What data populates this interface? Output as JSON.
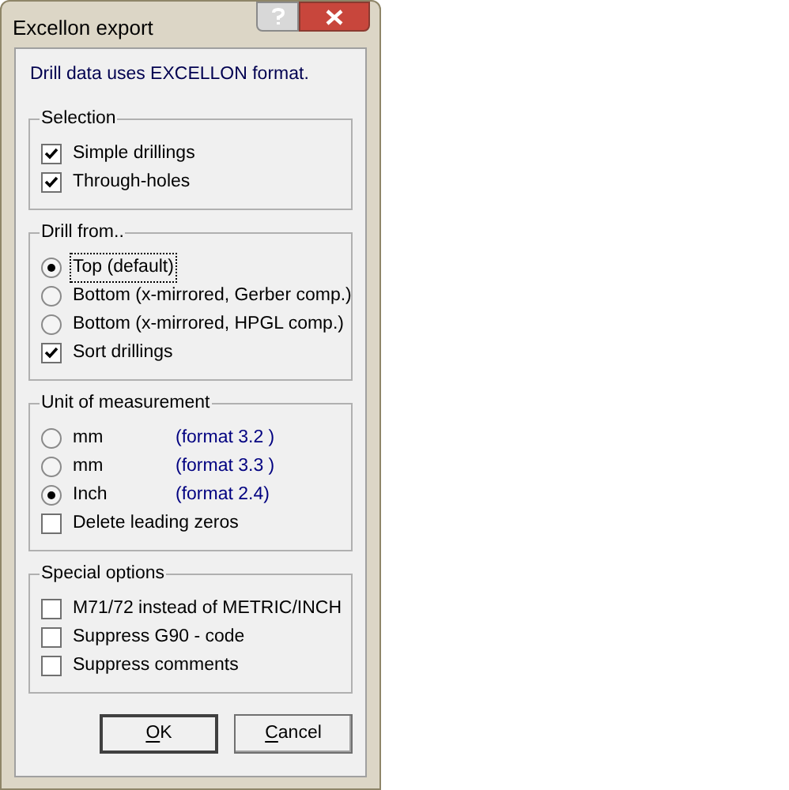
{
  "window": {
    "title": "Excellon export"
  },
  "intro": "Drill data uses EXCELLON format.",
  "groups": [
    {
      "title": "Selection",
      "items": [
        {
          "kind": "checkbox",
          "label": "Simple drillings",
          "checked": true,
          "focused": false
        },
        {
          "kind": "checkbox",
          "label": "Through-holes",
          "checked": true,
          "focused": false
        }
      ]
    },
    {
      "title": "Drill from..",
      "items": [
        {
          "kind": "radio",
          "label": "Top (default)",
          "selected": true,
          "focused": true
        },
        {
          "kind": "radio",
          "label": "Bottom (x-mirrored, Gerber comp.)",
          "selected": false,
          "focused": false
        },
        {
          "kind": "radio",
          "label": "Bottom (x-mirrored, HPGL comp.)",
          "selected": false,
          "focused": false
        },
        {
          "kind": "checkbox",
          "label": "Sort drillings",
          "checked": true,
          "focused": false
        }
      ]
    },
    {
      "title": "Unit of measurement",
      "items": [
        {
          "kind": "radio",
          "label": "mm",
          "format": "(format 3.2 )",
          "selected": false,
          "focused": false
        },
        {
          "kind": "radio",
          "label": "mm",
          "format": "(format 3.3 )",
          "selected": false,
          "focused": false
        },
        {
          "kind": "radio",
          "label": "Inch",
          "format": "(format 2.4)",
          "selected": true,
          "focused": false
        },
        {
          "kind": "checkbox",
          "label": "Delete leading zeros",
          "checked": false,
          "focused": false
        }
      ]
    },
    {
      "title": "Special options",
      "items": [
        {
          "kind": "checkbox",
          "label": "M71/72 instead of METRIC/INCH",
          "checked": false,
          "focused": false
        },
        {
          "kind": "checkbox",
          "label": "Suppress G90 - code",
          "checked": false,
          "focused": false
        },
        {
          "kind": "checkbox",
          "label": "Suppress comments",
          "checked": false,
          "focused": false
        }
      ]
    }
  ],
  "buttons": [
    {
      "label": "OK",
      "default": true
    },
    {
      "label": "Cancel",
      "default": false
    }
  ]
}
